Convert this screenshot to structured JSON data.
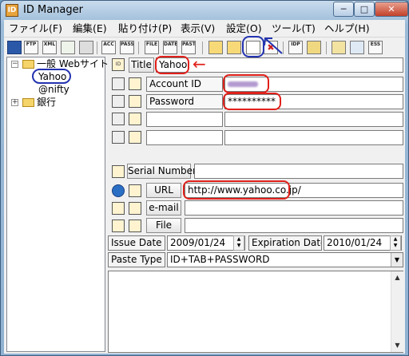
{
  "window": {
    "title": "ID Manager",
    "app_icon": "ID",
    "buttons": {
      "minimize": "─",
      "maximize": "□",
      "close": "✕"
    }
  },
  "menu": [
    {
      "label": "ファイル(F)"
    },
    {
      "label": "編集(E)"
    },
    {
      "label": "貼り付け(P)"
    },
    {
      "label": "表示(V)"
    },
    {
      "label": "設定(O)"
    },
    {
      "label": "ツール(T)"
    },
    {
      "label": "ヘルプ(H)"
    }
  ],
  "toolbar": [
    {
      "icon": "save-icon",
      "text": ""
    },
    {
      "icon": "ftp-icon",
      "text": "FTP"
    },
    {
      "icon": "xml-icon",
      "text": "XML"
    },
    {
      "icon": "grid-icon",
      "text": ""
    },
    {
      "icon": "print-icon",
      "text": ""
    },
    {
      "icon": "acc-icon",
      "text": "ACC"
    },
    {
      "icon": "pass-icon",
      "text": "PASS"
    },
    {
      "icon": "file-icon",
      "text": "FILE"
    },
    {
      "icon": "date-icon",
      "text": "DATE"
    },
    {
      "icon": "paste-icon",
      "text": "PASTE"
    },
    {
      "icon": "new-folder-icon",
      "text": ""
    },
    {
      "icon": "new-subfolder-icon",
      "text": ""
    },
    {
      "icon": "new-item-icon",
      "text": ""
    },
    {
      "icon": "delete-icon",
      "text": "✖"
    },
    {
      "icon": "idp-icon",
      "text": "IDP"
    },
    {
      "icon": "export-icon",
      "text": ""
    },
    {
      "icon": "lock-icon",
      "text": ""
    },
    {
      "icon": "window-icon",
      "text": ""
    },
    {
      "icon": "ess-icon",
      "text": "ESS"
    }
  ],
  "tree": {
    "root1": "一般 Webサイト",
    "child1": "Yahoo",
    "child2": "@nifty",
    "root2": "銀行",
    "expanded": "−",
    "collapsed": "+"
  },
  "form": {
    "title_label": "Title",
    "title_value": "Yahoo",
    "account_label": "Account ID",
    "account_value": "",
    "password_label": "Password",
    "password_value": "**********",
    "extra1_label": "",
    "extra1_value": "",
    "extra2_label": "",
    "extra2_value": "",
    "serial_label": "Serial Number",
    "serial_value": "",
    "url_label": "URL",
    "url_value": "http://www.yahoo.co.jp/",
    "email_label": "e-mail",
    "email_value": "",
    "file_label": "File",
    "file_value": "",
    "issue_label": "Issue Date",
    "issue_value": "2009/01/24",
    "expiration_label": "Expiration Date",
    "expiration_value": "2010/01/24",
    "paste_type_label": "Paste Type",
    "paste_type_value": "ID+TAB+PASSWORD",
    "notes": ""
  },
  "glyphs": {
    "spin_up": "▲",
    "spin_down": "▼",
    "dropdown": "▼",
    "scroll_up": "▲",
    "scroll_down": "▼"
  },
  "annotations": {
    "red_arrow": "←",
    "colors": {
      "red": "#e0201a",
      "blue": "#2333b0"
    }
  }
}
